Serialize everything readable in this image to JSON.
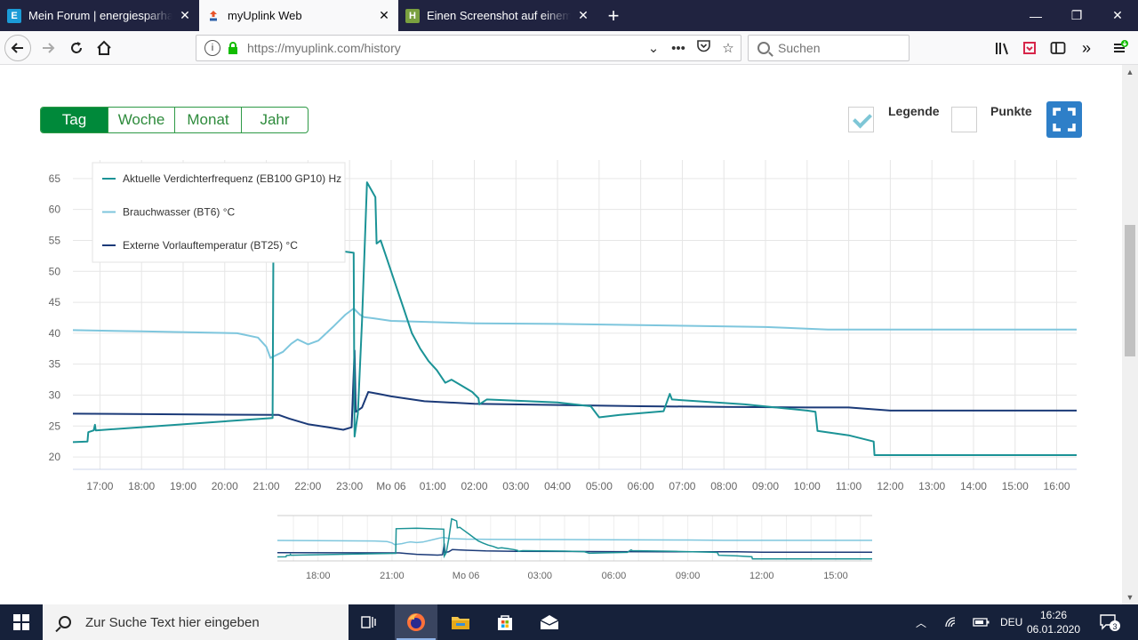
{
  "browser": {
    "tabs": [
      {
        "title": "Mein Forum | energiesparhaus.at",
        "icon": "E",
        "icon_color": "#1b9bd7",
        "active": false
      },
      {
        "title": "myUplink Web",
        "icon": "myuplink-icon",
        "active": true
      },
      {
        "title": "Einen Screenshot auf einem Desktop",
        "icon": "H",
        "icon_color": "#7aa03f",
        "active": false
      }
    ],
    "url_host": "https://myuplink.com",
    "url_path": "/history",
    "search_placeholder": "Suchen"
  },
  "toolbar": {
    "periods": [
      "Tag",
      "Woche",
      "Monat",
      "Jahr"
    ],
    "selected_period": "Tag",
    "legend_label": "Legende",
    "legend_checked": true,
    "points_label": "Punkte",
    "points_checked": false
  },
  "chart_data": {
    "type": "line",
    "ylim": [
      18,
      68
    ],
    "yticks": [
      20,
      25,
      30,
      35,
      40,
      45,
      50,
      55,
      60,
      65
    ],
    "xlim": [
      16.35,
      16.48
    ],
    "xticks": [
      {
        "h": 17,
        "label": "17:00"
      },
      {
        "h": 18,
        "label": "18:00"
      },
      {
        "h": 19,
        "label": "19:00"
      },
      {
        "h": 20,
        "label": "20:00"
      },
      {
        "h": 21,
        "label": "21:00"
      },
      {
        "h": 22,
        "label": "22:00"
      },
      {
        "h": 23,
        "label": "23:00"
      },
      {
        "h": 24,
        "label": "Mo 06"
      },
      {
        "h": 25,
        "label": "01:00"
      },
      {
        "h": 26,
        "label": "02:00"
      },
      {
        "h": 27,
        "label": "03:00"
      },
      {
        "h": 28,
        "label": "04:00"
      },
      {
        "h": 29,
        "label": "05:00"
      },
      {
        "h": 30,
        "label": "06:00"
      },
      {
        "h": 31,
        "label": "07:00"
      },
      {
        "h": 32,
        "label": "08:00"
      },
      {
        "h": 33,
        "label": "09:00"
      },
      {
        "h": 34,
        "label": "10:00"
      },
      {
        "h": 35,
        "label": "11:00"
      },
      {
        "h": 36,
        "label": "12:00"
      },
      {
        "h": 37,
        "label": "13:00"
      },
      {
        "h": 38,
        "label": "14:00"
      },
      {
        "h": 39,
        "label": "15:00"
      },
      {
        "h": 40,
        "label": "16:00"
      }
    ],
    "x_start_h": 16.35,
    "x_end_h": 40.48,
    "series": [
      {
        "name": "Aktuelle Verdichterfrequenz (EB100 GP10) Hz",
        "color": "#1b9396",
        "points": [
          [
            16.35,
            22.4
          ],
          [
            16.7,
            22.5
          ],
          [
            16.72,
            24.0
          ],
          [
            16.85,
            24.3
          ],
          [
            16.88,
            25.2
          ],
          [
            16.9,
            24.3
          ],
          [
            21.15,
            26.3
          ],
          [
            21.17,
            53.5
          ],
          [
            22.0,
            54.0
          ],
          [
            23.1,
            53.0
          ],
          [
            23.12,
            23.3
          ],
          [
            23.2,
            27.0
          ],
          [
            23.3,
            42.0
          ],
          [
            23.42,
            64.4
          ],
          [
            23.62,
            62.0
          ],
          [
            23.65,
            54.5
          ],
          [
            23.75,
            55.0
          ],
          [
            23.9,
            52.0
          ],
          [
            24.1,
            48.0
          ],
          [
            24.3,
            44.0
          ],
          [
            24.5,
            40.0
          ],
          [
            24.7,
            37.5
          ],
          [
            24.9,
            35.5
          ],
          [
            25.1,
            34.0
          ],
          [
            25.3,
            32.0
          ],
          [
            25.45,
            32.5
          ],
          [
            25.7,
            31.5
          ],
          [
            25.95,
            30.5
          ],
          [
            26.1,
            29.5
          ],
          [
            26.12,
            28.5
          ],
          [
            26.3,
            29.3
          ],
          [
            28.0,
            28.8
          ],
          [
            28.8,
            28.2
          ],
          [
            29.0,
            26.4
          ],
          [
            29.5,
            26.8
          ],
          [
            30.55,
            27.4
          ],
          [
            30.65,
            29.3
          ],
          [
            30.7,
            30.2
          ],
          [
            30.75,
            29.3
          ],
          [
            32.5,
            28.5
          ],
          [
            34.0,
            27.5
          ],
          [
            34.2,
            27.3
          ],
          [
            34.25,
            24.2
          ],
          [
            35.0,
            23.5
          ],
          [
            35.6,
            22.5
          ],
          [
            35.62,
            20.3
          ],
          [
            40.48,
            20.3
          ]
        ]
      },
      {
        "name": "Brauchwasser (BT6) °C",
        "color": "#7ec6dd",
        "points": [
          [
            16.35,
            40.5
          ],
          [
            18.0,
            40.3
          ],
          [
            20.3,
            40.0
          ],
          [
            20.8,
            39.3
          ],
          [
            21.0,
            37.8
          ],
          [
            21.1,
            36.0
          ],
          [
            21.4,
            37.0
          ],
          [
            21.6,
            38.3
          ],
          [
            21.75,
            39.0
          ],
          [
            22.0,
            38.2
          ],
          [
            22.25,
            38.8
          ],
          [
            22.6,
            41.0
          ],
          [
            22.9,
            43.0
          ],
          [
            23.1,
            44.0
          ],
          [
            23.25,
            43.0
          ],
          [
            23.35,
            42.6
          ],
          [
            23.6,
            42.4
          ],
          [
            24.0,
            42.0
          ],
          [
            25.0,
            41.8
          ],
          [
            26.0,
            41.6
          ],
          [
            28.0,
            41.5
          ],
          [
            30.0,
            41.3
          ],
          [
            33.0,
            41.0
          ],
          [
            34.5,
            40.6
          ],
          [
            40.48,
            40.6
          ]
        ]
      },
      {
        "name": "Externe Vorlauftemperatur (BT25) °C",
        "color": "#1b3a78",
        "points": [
          [
            16.35,
            27.0
          ],
          [
            21.3,
            26.8
          ],
          [
            21.55,
            26.2
          ],
          [
            22.0,
            25.3
          ],
          [
            22.5,
            24.8
          ],
          [
            22.85,
            24.4
          ],
          [
            23.05,
            24.8
          ],
          [
            23.12,
            37.2
          ],
          [
            23.15,
            27.3
          ],
          [
            23.3,
            28.0
          ],
          [
            23.45,
            30.5
          ],
          [
            23.7,
            30.2
          ],
          [
            24.0,
            29.8
          ],
          [
            24.8,
            29.0
          ],
          [
            26.0,
            28.6
          ],
          [
            28.0,
            28.4
          ],
          [
            30.0,
            28.2
          ],
          [
            32.0,
            28.1
          ],
          [
            34.0,
            28.0
          ],
          [
            35.0,
            28.0
          ],
          [
            36.0,
            27.5
          ],
          [
            40.48,
            27.5
          ]
        ]
      }
    ]
  },
  "navigator": {
    "labels": [
      {
        "h": 18,
        "label": "18:00"
      },
      {
        "h": 21,
        "label": "21:00"
      },
      {
        "h": 24,
        "label": "Mo 06"
      },
      {
        "h": 27,
        "label": "03:00"
      },
      {
        "h": 30,
        "label": "06:00"
      },
      {
        "h": 33,
        "label": "09:00"
      },
      {
        "h": 36,
        "label": "12:00"
      },
      {
        "h": 39,
        "label": "15:00"
      }
    ]
  },
  "taskbar": {
    "search_placeholder": "Zur Suche Text hier eingeben",
    "language": "DEU",
    "time": "16:26",
    "date": "06.01.2020",
    "notification_count": "3"
  }
}
